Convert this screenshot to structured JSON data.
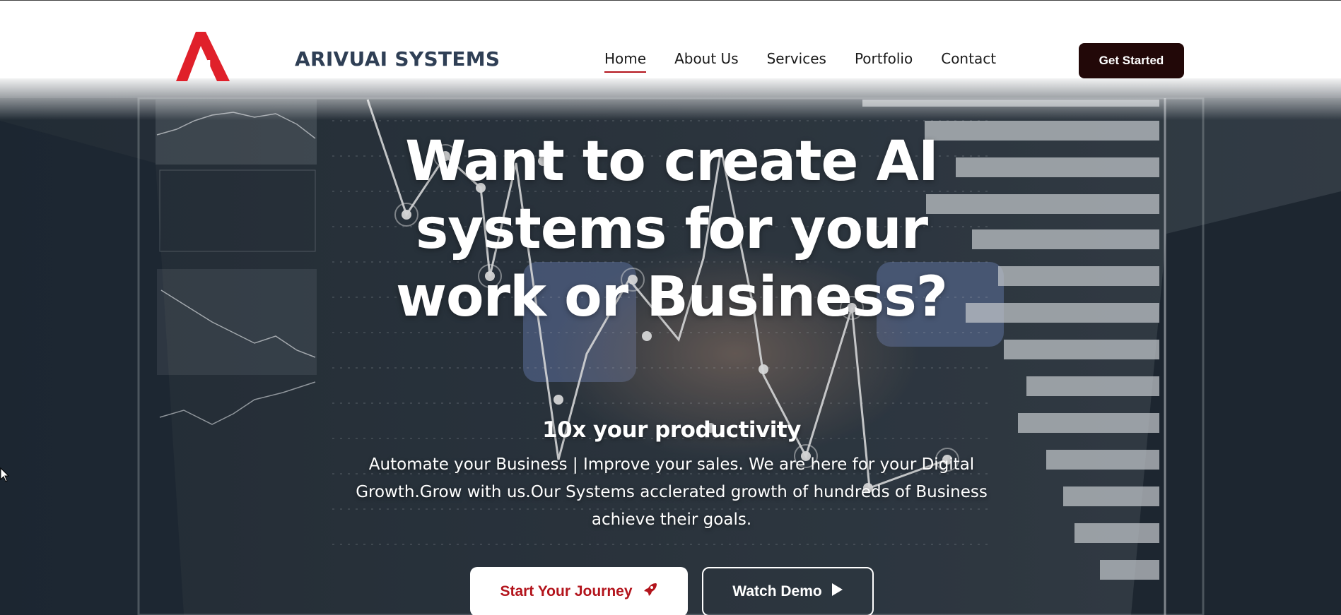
{
  "brand": {
    "name": "ARIVUAI SYSTEMS",
    "logo_text": "AI",
    "logo_icon": "triangle-a-logo",
    "color": "#e0202a"
  },
  "nav": {
    "items": [
      {
        "label": "Home",
        "active": true
      },
      {
        "label": "About Us",
        "active": false
      },
      {
        "label": "Services",
        "active": false
      },
      {
        "label": "Portfolio",
        "active": false
      },
      {
        "label": "Contact",
        "active": false
      }
    ],
    "cta_label": "Get Started"
  },
  "hero": {
    "headline": "Want to create AI systems for your work or Business?",
    "subheading": "10x your productivity",
    "description": "Automate your Business | Improve your sales. We are here for your Digital Growth.Grow with us.Our Systems acclerated growth of hundreds of Business achieve their goals.",
    "primary_button": {
      "label": "Start Your Journey",
      "icon": "rocket-icon"
    },
    "secondary_button": {
      "label": "Watch Demo",
      "icon": "play-icon"
    }
  },
  "colors": {
    "accent": "#b3141c",
    "cta_bg": "#220808",
    "brand_text": "#2f3f55"
  }
}
